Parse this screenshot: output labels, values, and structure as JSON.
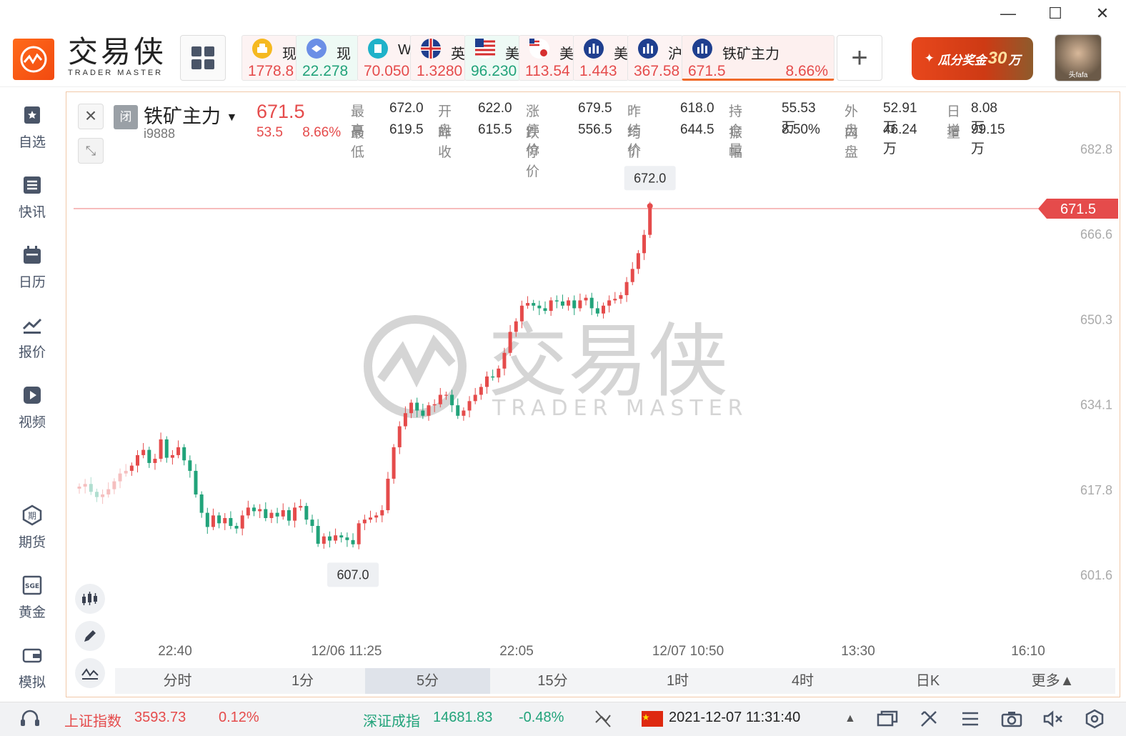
{
  "window": {
    "minimize": "—",
    "maximize": "☐",
    "close": "✕"
  },
  "brand": {
    "name_cn": "交易侠",
    "name_en": "TRADER MASTER"
  },
  "tickers": [
    {
      "name": "现",
      "price": "1778.8",
      "flag": "gold",
      "color": "red"
    },
    {
      "name": "现",
      "price": "22.278",
      "flag": "silver",
      "color": "green"
    },
    {
      "name": "W",
      "price": "70.050",
      "flag": "oil",
      "color": "red"
    },
    {
      "name": "英",
      "price": "1.3280",
      "flag": "uk",
      "color": "red"
    },
    {
      "name": "美",
      "price": "96.230",
      "flag": "us",
      "color": "green"
    },
    {
      "name": "美",
      "price": "113.54",
      "flag": "usjp",
      "color": "red"
    },
    {
      "name": "美",
      "price": "1.443",
      "flag": "index",
      "color": "red"
    },
    {
      "name": "沪",
      "price": "367.58",
      "flag": "index",
      "color": "red"
    },
    {
      "name": "铁矿主力",
      "price": "671.5",
      "pct": "8.66%",
      "flag": "index",
      "color": "red",
      "active": true
    }
  ],
  "add_label": "+",
  "promo": {
    "prefix": "瓜分奖金",
    "amount": "30",
    "suffix": "万"
  },
  "avatar_name": "头fafa",
  "sidebar": [
    {
      "label": "自选",
      "icon": "bookmark-icon"
    },
    {
      "label": "快讯",
      "icon": "news-icon"
    },
    {
      "label": "日历",
      "icon": "calendar-icon"
    },
    {
      "label": "报价",
      "icon": "quote-chart-icon"
    },
    {
      "label": "视频",
      "icon": "video-icon"
    },
    {
      "label": "期货",
      "icon": "futures-icon"
    },
    {
      "label": "黄金",
      "icon": "sge-icon"
    },
    {
      "label": "模拟",
      "icon": "wallet-icon"
    }
  ],
  "quote": {
    "closed_tag": "闭",
    "name": "铁矿主力",
    "code": "i9888",
    "price": "671.5",
    "change": "53.5",
    "change_pct": "8.66%",
    "stats": [
      {
        "label": "最高",
        "value": "672.0",
        "color": "red"
      },
      {
        "label": "开盘",
        "value": "622.0",
        "color": "red"
      },
      {
        "label": "涨停价",
        "value": "679.5",
        "color": "normal"
      },
      {
        "label": "昨结价",
        "value": "618.0",
        "color": "normal"
      },
      {
        "label": "持仓量",
        "value": "55.53万",
        "color": "normal"
      },
      {
        "label": "外盘",
        "value": "52.91万",
        "color": "normal"
      },
      {
        "label": "日增",
        "value": "8.08万",
        "color": "normal"
      },
      {
        "label": "最低",
        "value": "619.5",
        "color": "red"
      },
      {
        "label": "昨收",
        "value": "615.5",
        "color": "normal"
      },
      {
        "label": "跌停价",
        "value": "556.5",
        "color": "normal"
      },
      {
        "label": "均价",
        "value": "644.5",
        "color": "normal"
      },
      {
        "label": "振幅",
        "value": "8.50%",
        "color": "normal"
      },
      {
        "label": "内盘",
        "value": "46.24万",
        "color": "normal"
      },
      {
        "label": "量",
        "value": "99.15万",
        "color": "normal"
      }
    ]
  },
  "chart_data": {
    "type": "candlestick",
    "y_ticks": [
      "682.8",
      "666.6",
      "650.3",
      "634.1",
      "617.8",
      "601.6"
    ],
    "ylim": [
      601.6,
      682.8
    ],
    "x_ticks": [
      "22:40",
      "12/06 11:25",
      "22:05",
      "12/07 10:50",
      "13:30",
      "16:10"
    ],
    "current_price_label": "671.5",
    "current_price": 671.5,
    "high_label": "672.0",
    "high": 672.0,
    "low_label": "607.0",
    "low": 607.0,
    "watermark_cn": "交易侠",
    "watermark_en": "TRADER MASTER",
    "up_color": "#e54b4b",
    "down_color": "#21a37a",
    "closes": [
      618.5,
      619,
      617.5,
      616.5,
      617,
      618,
      619.5,
      621,
      621.5,
      622.5,
      624.5,
      625.5,
      623,
      623.8,
      627.5,
      624,
      624.5,
      626,
      623.5,
      621.5,
      617,
      613.5,
      610.8,
      613,
      611.5,
      612.5,
      611,
      610.5,
      613,
      614.5,
      613.8,
      614.2,
      612.5,
      613.5,
      612.8,
      614,
      612,
      614.5,
      614.8,
      612.2,
      611,
      607.6,
      609,
      608.2,
      609.2,
      608.8,
      608.3,
      607.5,
      611.5,
      612.2,
      612.6,
      613,
      614,
      620,
      626,
      630,
      632.5,
      634.5,
      633,
      632,
      634,
      634.2,
      636,
      636,
      634,
      632,
      633,
      634.8,
      636,
      637.5,
      639.5,
      639.3,
      641,
      644,
      648,
      650,
      653,
      653.5,
      653,
      652.5,
      652,
      654,
      653.8,
      653,
      654,
      652.5,
      654,
      654.5,
      652.5,
      651.5,
      653,
      654,
      654.3,
      655,
      657.5,
      660,
      663,
      666.5,
      671.5
    ]
  },
  "tools": [
    "candle-tool-icon",
    "pencil-icon",
    "indicator-icon"
  ],
  "periods": [
    "分时",
    "1分",
    "5分",
    "15分",
    "1时",
    "4时",
    "日K",
    "更多▲"
  ],
  "active_period": "5分",
  "status": {
    "sh_name": "上证指数",
    "sh_val": "3593.73",
    "sh_pct": "0.12%",
    "sz_name": "深证成指",
    "sz_val": "14681.83",
    "sz_pct": "-0.48%",
    "datetime": "2021-12-07 11:31:40",
    "arrow": "▲"
  }
}
